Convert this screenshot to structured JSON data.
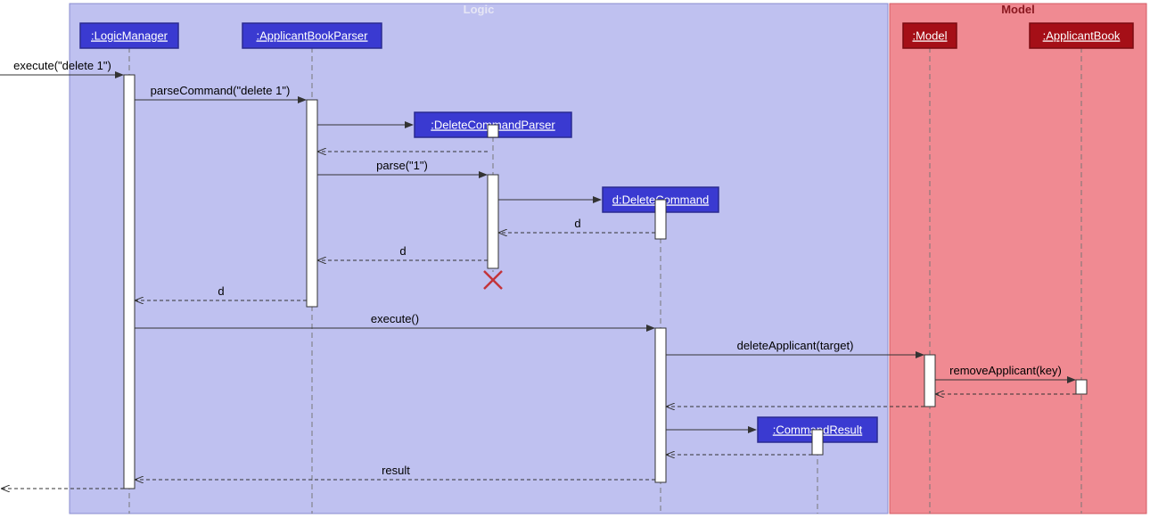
{
  "regions": {
    "logic": {
      "label": "Logic"
    },
    "model": {
      "label": "Model"
    }
  },
  "participants": {
    "logicManager": {
      "label": ":LogicManager"
    },
    "applicantBookParser": {
      "label": ":ApplicantBookParser"
    },
    "deleteCommandParser": {
      "label": ":DeleteCommandParser"
    },
    "deleteCommand": {
      "label": "d:DeleteCommand"
    },
    "commandResult": {
      "label": ":CommandResult"
    },
    "model": {
      "label": ":Model"
    },
    "applicantBook": {
      "label": ":ApplicantBook"
    }
  },
  "messages": {
    "m1": "execute(\"delete 1\")",
    "m2": "parseCommand(\"delete 1\")",
    "m3": "parse(\"1\")",
    "m4": "d",
    "m5": "d",
    "m6": "d",
    "m7": "execute()",
    "m8": "deleteApplicant(target)",
    "m9": "removeApplicant(key)",
    "m10": "result"
  },
  "chart_data": {
    "type": "sequence-diagram",
    "regions": [
      {
        "name": "Logic",
        "participants": [
          ":LogicManager",
          ":ApplicantBookParser",
          ":DeleteCommandParser",
          "d:DeleteCommand",
          ":CommandResult"
        ]
      },
      {
        "name": "Model",
        "participants": [
          ":Model",
          ":ApplicantBook"
        ]
      }
    ],
    "messages": [
      {
        "from": "caller",
        "to": ":LogicManager",
        "label": "execute(\"delete 1\")",
        "type": "sync"
      },
      {
        "from": ":LogicManager",
        "to": ":ApplicantBookParser",
        "label": "parseCommand(\"delete 1\")",
        "type": "sync"
      },
      {
        "from": ":ApplicantBookParser",
        "to": ":DeleteCommandParser",
        "label": "",
        "type": "create"
      },
      {
        "from": ":DeleteCommandParser",
        "to": ":ApplicantBookParser",
        "label": "",
        "type": "return"
      },
      {
        "from": ":ApplicantBookParser",
        "to": ":DeleteCommandParser",
        "label": "parse(\"1\")",
        "type": "sync"
      },
      {
        "from": ":DeleteCommandParser",
        "to": "d:DeleteCommand",
        "label": "",
        "type": "create"
      },
      {
        "from": "d:DeleteCommand",
        "to": ":DeleteCommandParser",
        "label": "d",
        "type": "return"
      },
      {
        "from": ":DeleteCommandParser",
        "to": ":ApplicantBookParser",
        "label": "d",
        "type": "return"
      },
      {
        "from": ":DeleteCommandParser",
        "to": null,
        "label": "",
        "type": "destroy"
      },
      {
        "from": ":ApplicantBookParser",
        "to": ":LogicManager",
        "label": "d",
        "type": "return"
      },
      {
        "from": ":LogicManager",
        "to": "d:DeleteCommand",
        "label": "execute()",
        "type": "sync"
      },
      {
        "from": "d:DeleteCommand",
        "to": ":Model",
        "label": "deleteApplicant(target)",
        "type": "sync"
      },
      {
        "from": ":Model",
        "to": ":ApplicantBook",
        "label": "removeApplicant(key)",
        "type": "sync"
      },
      {
        "from": ":ApplicantBook",
        "to": ":Model",
        "label": "",
        "type": "return"
      },
      {
        "from": ":Model",
        "to": "d:DeleteCommand",
        "label": "",
        "type": "return"
      },
      {
        "from": "d:DeleteCommand",
        "to": ":CommandResult",
        "label": "",
        "type": "create"
      },
      {
        "from": ":CommandResult",
        "to": "d:DeleteCommand",
        "label": "",
        "type": "return"
      },
      {
        "from": "d:DeleteCommand",
        "to": ":LogicManager",
        "label": "result",
        "type": "return"
      },
      {
        "from": ":LogicManager",
        "to": "caller",
        "label": "",
        "type": "return"
      }
    ]
  }
}
